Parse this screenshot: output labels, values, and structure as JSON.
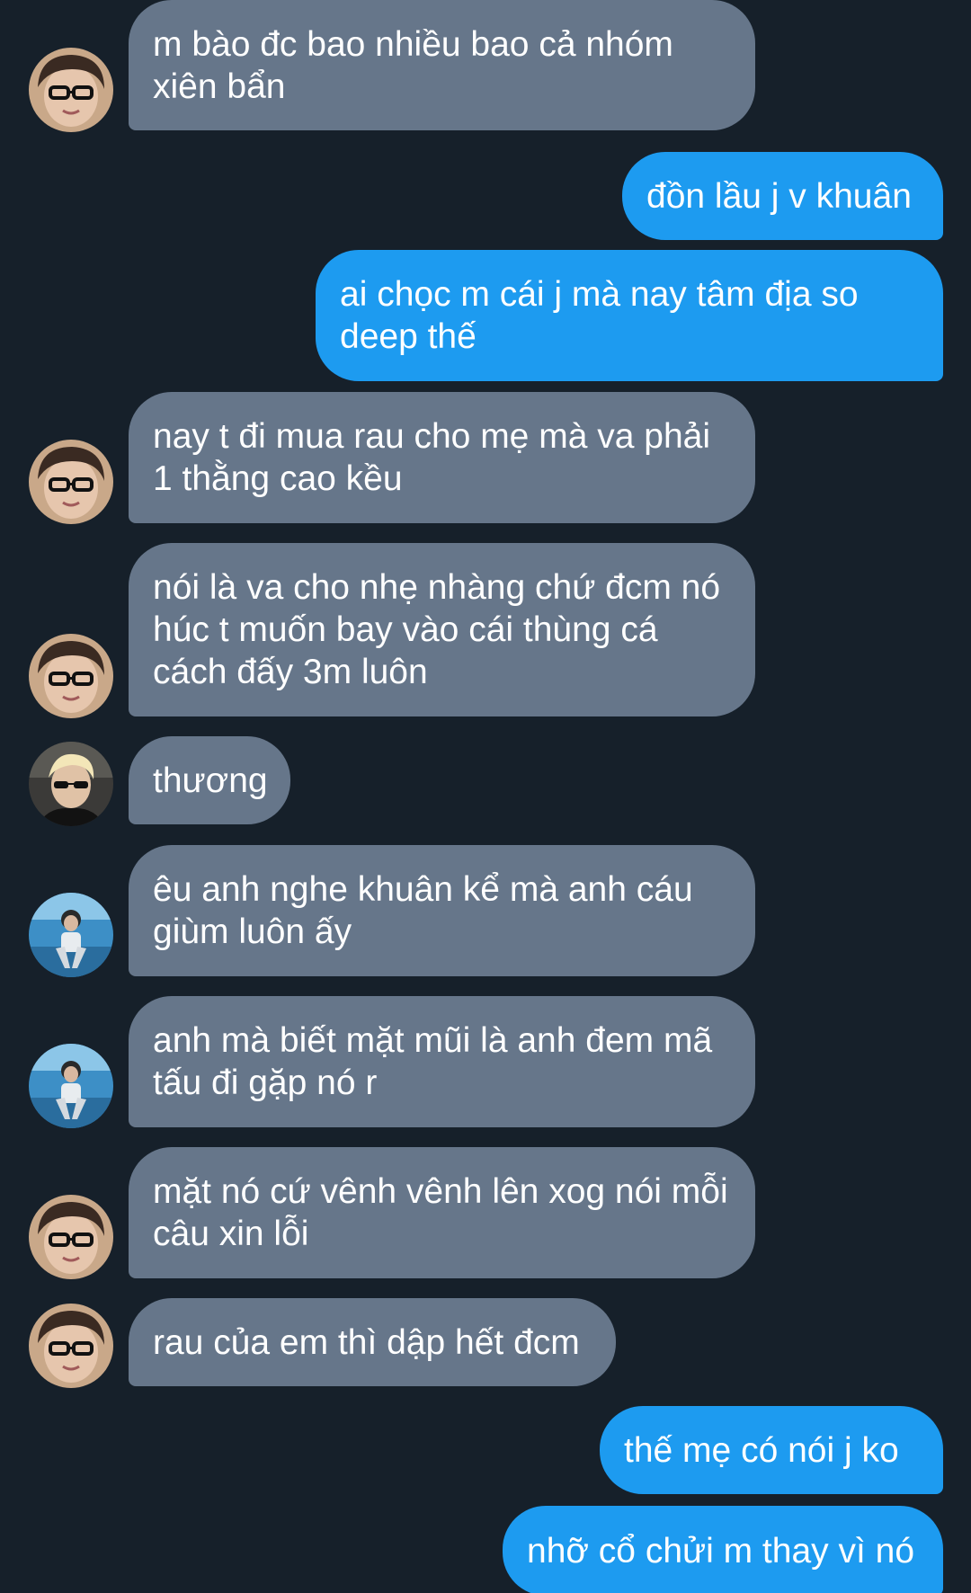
{
  "theme": {
    "background": "#16202a",
    "incoming_bubble": "#66768a",
    "outgoing_bubble": "#1d9bf0",
    "text": "#ffffff"
  },
  "messages": [
    {
      "from": "them",
      "avatar": "avatar-glasses-icon",
      "text": "m bào đc bao nhiều bao cả nhóm xiên bẩn"
    },
    {
      "from": "me",
      "text": "đồn lầu j v khuân"
    },
    {
      "from": "me",
      "text": "ai chọc m cái j mà nay tâm địa so deep thế"
    },
    {
      "from": "them",
      "avatar": "avatar-glasses-icon",
      "text": "nay t đi mua rau cho mẹ mà va phải 1 thằng cao kều"
    },
    {
      "from": "them",
      "avatar": "avatar-glasses-icon",
      "text": "nói là va cho nhẹ nhàng chứ đcm nó húc t muốn bay vào cái thùng cá cách đấy 3m luôn"
    },
    {
      "from": "them",
      "avatar": "avatar-blonde-icon",
      "text": "thương"
    },
    {
      "from": "them",
      "avatar": "avatar-sitting-icon",
      "text": "êu anh nghe khuân kể mà anh cáu giùm luôn ấy"
    },
    {
      "from": "them",
      "avatar": "avatar-sitting-icon",
      "text": "anh mà biết mặt mũi là anh đem mã tấu đi gặp nó r"
    },
    {
      "from": "them",
      "avatar": "avatar-glasses-icon",
      "text": "mặt nó cứ vênh vênh lên xog nói mỗi câu xin lỗi"
    },
    {
      "from": "them",
      "avatar": "avatar-glasses-icon",
      "text": "rau của em thì dập hết đcm"
    },
    {
      "from": "me",
      "text": "thế mẹ có nói j ko"
    },
    {
      "from": "me",
      "text": "nhỡ cổ chửi m thay vì nó"
    }
  ]
}
